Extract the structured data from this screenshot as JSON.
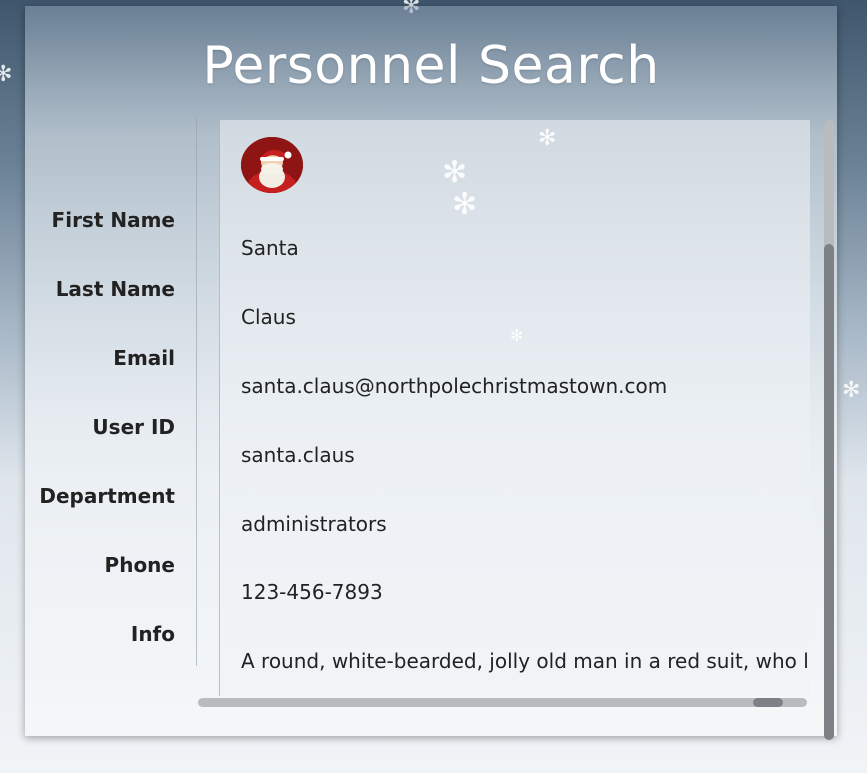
{
  "page": {
    "title": "Personnel Search"
  },
  "fields": {
    "first_name": {
      "label": "First Name",
      "value": "Santa"
    },
    "last_name": {
      "label": "Last Name",
      "value": "Claus"
    },
    "email": {
      "label": "Email",
      "value": "santa.claus@northpolechristmastown.com"
    },
    "user_id": {
      "label": "User ID",
      "value": "santa.claus"
    },
    "department": {
      "label": "Department",
      "value": "administrators"
    },
    "phone": {
      "label": "Phone",
      "value": "123-456-7893"
    },
    "info": {
      "label": "Info",
      "value": "A round, white-bearded, jolly old man in a red suit, who liv"
    }
  },
  "icons": {
    "avatar": "santa-avatar-icon",
    "snowflake": "snowflake-icon"
  },
  "colors": {
    "title": "#ffffff",
    "label_text": "#222222",
    "scroll_track": "#b9bcbf",
    "scroll_thumb": "#7d8084",
    "suit_red": "#c51f1f"
  }
}
